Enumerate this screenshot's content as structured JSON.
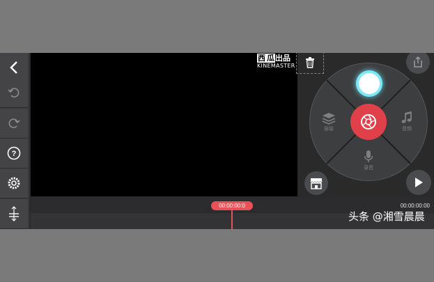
{
  "toolbar": {
    "back": {
      "icon": "chevron-left-icon"
    },
    "undo": {
      "icon": "undo-icon"
    },
    "redo": {
      "icon": "redo-icon"
    },
    "help": {
      "icon": "help-icon"
    },
    "settings": {
      "icon": "gear-icon"
    },
    "adjust": {
      "icon": "vertical-adjust-icon"
    }
  },
  "preview": {
    "watermark_top_left": "西",
    "watermark_top_mid": "瓜",
    "watermark_top_right": "出品",
    "watermark_brand": "KINEMASTER"
  },
  "wheel": {
    "layers_label": "层级",
    "audio_label": "音频",
    "voice_label": "录音",
    "accent_color": "#e0404a",
    "record_color": "#7fe8f4"
  },
  "timeline": {
    "current_time": "00:00:00:0",
    "total_time": "00:00:00:00"
  },
  "credit": "头条 @湘雪晨晨"
}
